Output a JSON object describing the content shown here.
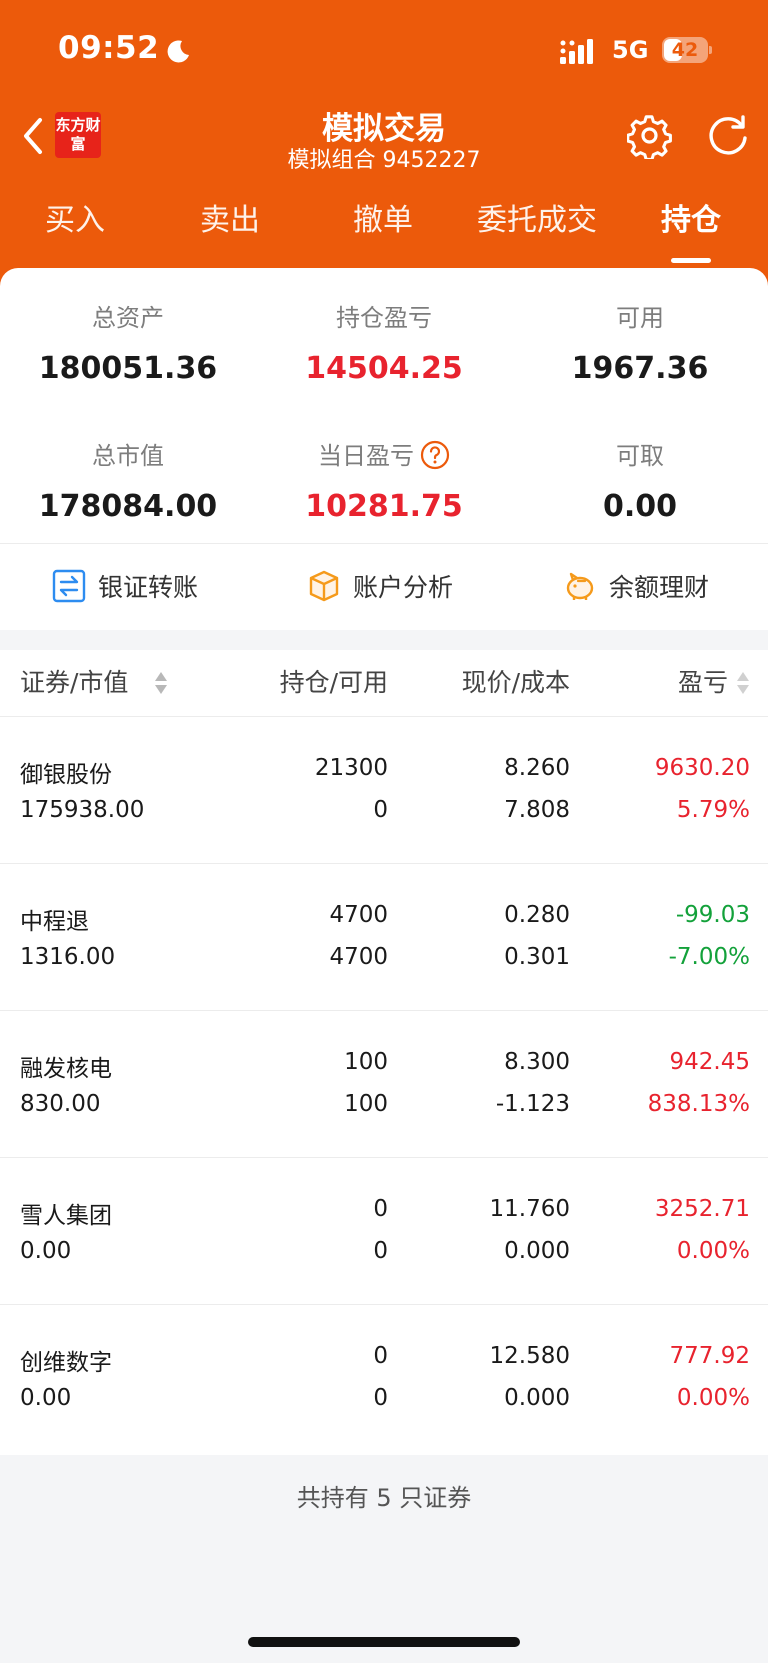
{
  "status_bar": {
    "time": "09:52",
    "network": "5G",
    "battery": "42",
    "battery_level": 0.42
  },
  "header": {
    "logo_text": "东方财富",
    "title": "模拟交易",
    "subtitle": "模拟组合 9452227"
  },
  "tabs": [
    {
      "label": "买入"
    },
    {
      "label": "卖出"
    },
    {
      "label": "撤单"
    },
    {
      "label": "委托成交"
    },
    {
      "label": "持仓"
    }
  ],
  "active_tab": "持仓",
  "summary": {
    "total_assets_label": "总资产",
    "total_assets": "180051.36",
    "position_pl_label": "持仓盈亏",
    "position_pl": "14504.25",
    "available_label": "可用",
    "available": "1967.36",
    "market_value_label": "总市值",
    "market_value": "178084.00",
    "daily_pl_label": "当日盈亏",
    "daily_pl": "10281.75",
    "withdrawable_label": "可取",
    "withdrawable": "0.00"
  },
  "actions": [
    {
      "label": "银证转账",
      "icon": "transfer-icon"
    },
    {
      "label": "账户分析",
      "icon": "box-icon"
    },
    {
      "label": "余额理财",
      "icon": "piggy-bank-icon"
    }
  ],
  "table": {
    "headers": {
      "security": "证券/市值",
      "position": "持仓/可用",
      "price": "现价/成本",
      "pl": "盈亏"
    },
    "rows": [
      {
        "name": "御银股份",
        "market_value": "175938.00",
        "position": "21300",
        "available": "0",
        "price": "8.260",
        "cost": "7.808",
        "pl": "9630.20",
        "pl_pct": "5.79%",
        "tone": "red"
      },
      {
        "name": "中程退",
        "market_value": "1316.00",
        "position": "4700",
        "available": "4700",
        "price": "0.280",
        "cost": "0.301",
        "pl": "-99.03",
        "pl_pct": "-7.00%",
        "tone": "green"
      },
      {
        "name": "融发核电",
        "market_value": "830.00",
        "position": "100",
        "available": "100",
        "price": "8.300",
        "cost": "-1.123",
        "pl": "942.45",
        "pl_pct": "838.13%",
        "tone": "red"
      },
      {
        "name": "雪人集团",
        "market_value": "0.00",
        "position": "0",
        "available": "0",
        "price": "11.760",
        "cost": "0.000",
        "pl": "3252.71",
        "pl_pct": "0.00%",
        "tone": "red"
      },
      {
        "name": "创维数字",
        "market_value": "0.00",
        "position": "0",
        "available": "0",
        "price": "12.580",
        "cost": "0.000",
        "pl": "777.92",
        "pl_pct": "0.00%",
        "tone": "red"
      }
    ]
  },
  "footer_text": "共持有 5 只证券",
  "colors": {
    "header_bg": "#ec5a0b",
    "gain": "#e8232e",
    "loss": "#13a13a",
    "logo_bg": "#e7231a"
  }
}
